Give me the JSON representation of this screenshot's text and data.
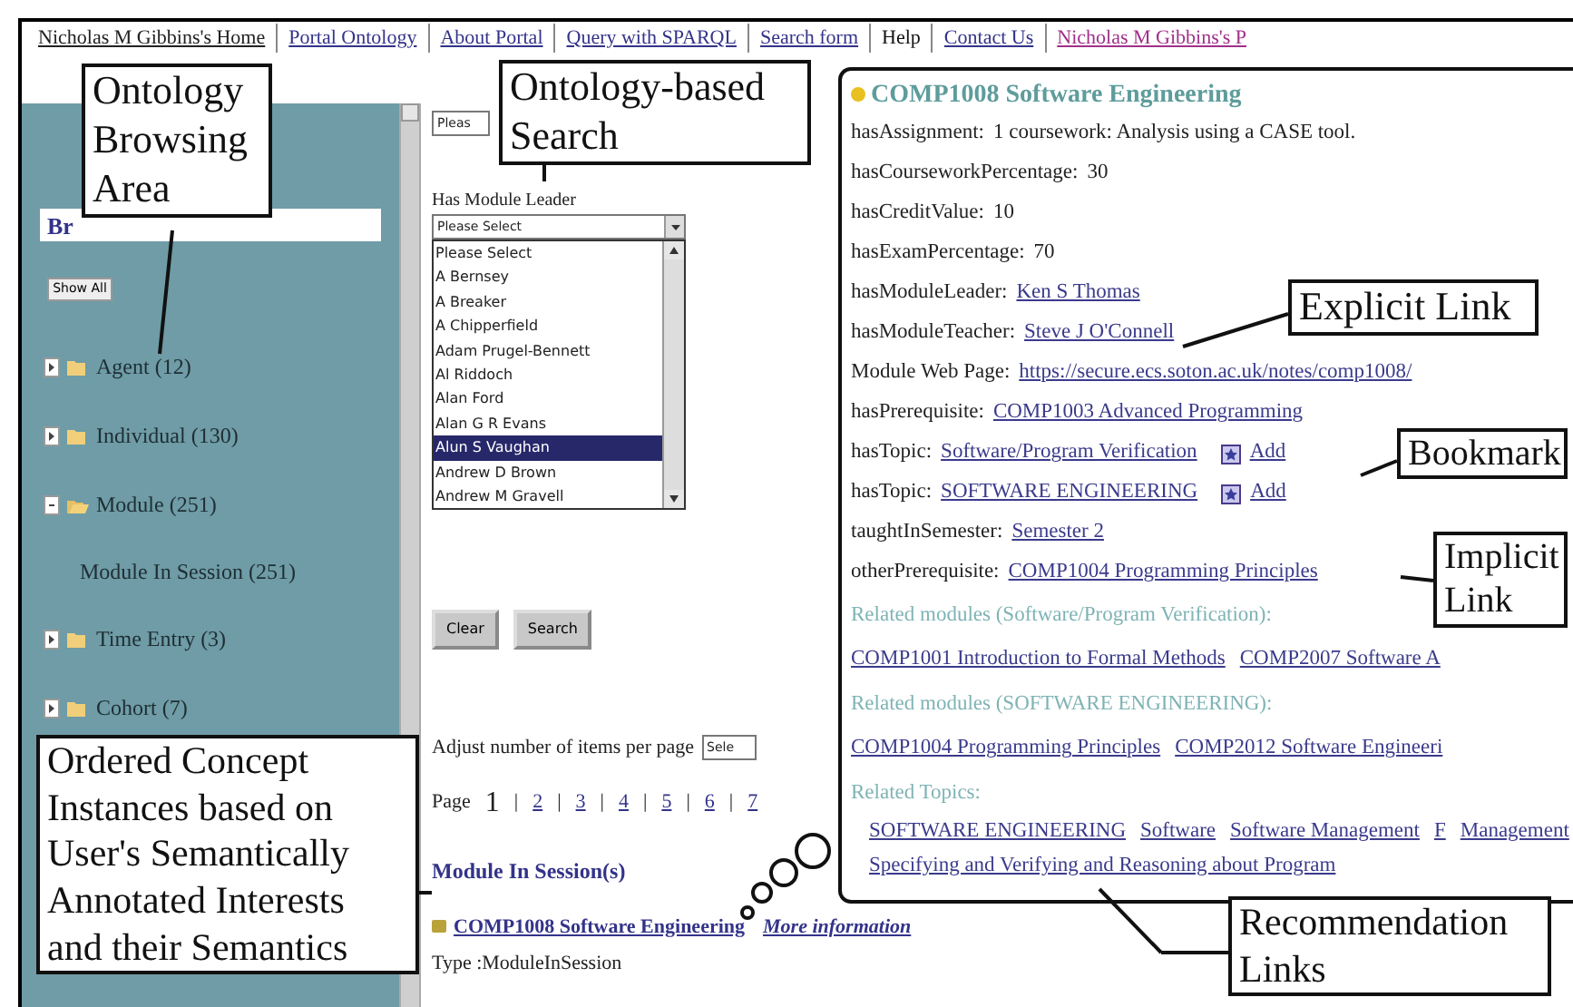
{
  "nav": [
    {
      "label": "Nicholas M Gibbins's Home",
      "kind": "home"
    },
    {
      "label": "Portal Ontology",
      "kind": "link"
    },
    {
      "label": "About Portal",
      "kind": "link"
    },
    {
      "label": "Query with SPARQL",
      "kind": "link"
    },
    {
      "label": "Search form",
      "kind": "link"
    },
    {
      "label": "Help",
      "kind": "current"
    },
    {
      "label": "Contact Us",
      "kind": "link"
    },
    {
      "label": "Nicholas M Gibbins's P",
      "kind": "visited"
    }
  ],
  "sidebar": {
    "heading": "Br",
    "show_all": "Show All",
    "tree": [
      {
        "label": "Agent (12)",
        "expanded": false
      },
      {
        "label": "Individual (130)",
        "expanded": false
      },
      {
        "label": "Module (251)",
        "expanded": true,
        "children": [
          {
            "label": "Module In Session (251)"
          }
        ]
      },
      {
        "label": "Time Entry (3)",
        "expanded": false
      },
      {
        "label": "Cohort (7)",
        "expanded": false
      }
    ]
  },
  "search": {
    "top_select": "Pleas",
    "field_label": "Has Module Leader",
    "select_value": "Please Select",
    "options": [
      {
        "label": "Please Select",
        "selected": false
      },
      {
        "label": "A Bernsey",
        "selected": false
      },
      {
        "label": "A Breaker",
        "selected": false
      },
      {
        "label": "A Chipperfield",
        "selected": false
      },
      {
        "label": "Adam Prugel-Bennett",
        "selected": false
      },
      {
        "label": "Al Riddoch",
        "selected": false
      },
      {
        "label": "Alan Ford",
        "selected": false
      },
      {
        "label": "Alan G R Evans",
        "selected": false
      },
      {
        "label": "Alun S Vaughan",
        "selected": true
      },
      {
        "label": "Andrew D Brown",
        "selected": false
      },
      {
        "label": "Andrew M Gravell",
        "selected": false
      }
    ],
    "buttons": [
      "Clear",
      "Search"
    ],
    "per_page_label": "Adjust number of items per page",
    "per_page_select": "Sele",
    "page_label": "Page",
    "page_separator": "|",
    "pages": [
      {
        "label": "1",
        "selected": true
      },
      {
        "label": "2",
        "selected": false
      },
      {
        "label": "3",
        "selected": false
      },
      {
        "label": "4",
        "selected": false
      },
      {
        "label": "5",
        "selected": false
      },
      {
        "label": "6",
        "selected": false
      },
      {
        "label": "7",
        "selected": false
      }
    ]
  },
  "results": {
    "heading": "Module In Session(s)",
    "items": [
      {
        "title": "COMP1008 Software Engineering",
        "more": "More information",
        "type": "Type :ModuleInSession"
      }
    ]
  },
  "popup": {
    "title": "COMP1008 Software Engineering",
    "properties": [
      {
        "name": "hasAssignment:",
        "value": "1 coursework: Analysis using a CASE tool.",
        "kind": "text"
      },
      {
        "name": "hasCourseworkPercentage:",
        "value": "30",
        "kind": "text"
      },
      {
        "name": "hasCreditValue:",
        "value": "10",
        "kind": "text"
      },
      {
        "name": "hasExamPercentage:",
        "value": "70",
        "kind": "text"
      },
      {
        "name": "hasModuleLeader:",
        "value": "Ken S Thomas",
        "kind": "link"
      },
      {
        "name": "hasModuleTeacher:",
        "value": "Steve J O'Connell",
        "kind": "link"
      },
      {
        "name": "Module Web Page:",
        "value": "https://secure.ecs.soton.ac.uk/notes/comp1008/",
        "kind": "link"
      },
      {
        "name": "hasPrerequisite:",
        "value": "COMP1003 Advanced Programming",
        "kind": "link"
      },
      {
        "name": "hasTopic:",
        "value": "Software/Program Verification",
        "kind": "link",
        "bookmark": "Add"
      },
      {
        "name": "hasTopic:",
        "value": "SOFTWARE ENGINEERING",
        "kind": "link",
        "bookmark": "Add"
      },
      {
        "name": "taughtInSemester:",
        "value": "Semester 2",
        "kind": "link"
      },
      {
        "name": "otherPrerequisite:",
        "value": "COMP1004 Programming Principles",
        "kind": "link"
      }
    ],
    "related": [
      {
        "heading": "Related modules (Software/Program Verification):",
        "links": [
          "COMP1001 Introduction to Formal Methods",
          "COMP2007 Software A"
        ]
      },
      {
        "heading": "Related modules (SOFTWARE ENGINEERING):",
        "links": [
          "COMP1004 Programming Principles",
          "COMP2012 Software Engineeri"
        ]
      },
      {
        "heading": "Related Topics:",
        "links": [
          "SOFTWARE ENGINEERING",
          "Software",
          "Software Management",
          "F",
          "Management",
          "Specifying and Verifying and Reasoning about Program"
        ]
      }
    ]
  },
  "callouts": [
    {
      "text": "Ontology\nBrowsing\nArea"
    },
    {
      "text": "Ontology-based\nSearch"
    },
    {
      "text": "Explicit Link"
    },
    {
      "text": "Bookmark"
    },
    {
      "text": "Implicit\nLink"
    },
    {
      "text": "Ordered Concept\nInstances based on\nUser's Semantically\nAnnotated Interests\nand their Semantics"
    },
    {
      "text": "Recommendation\nLinks"
    }
  ]
}
